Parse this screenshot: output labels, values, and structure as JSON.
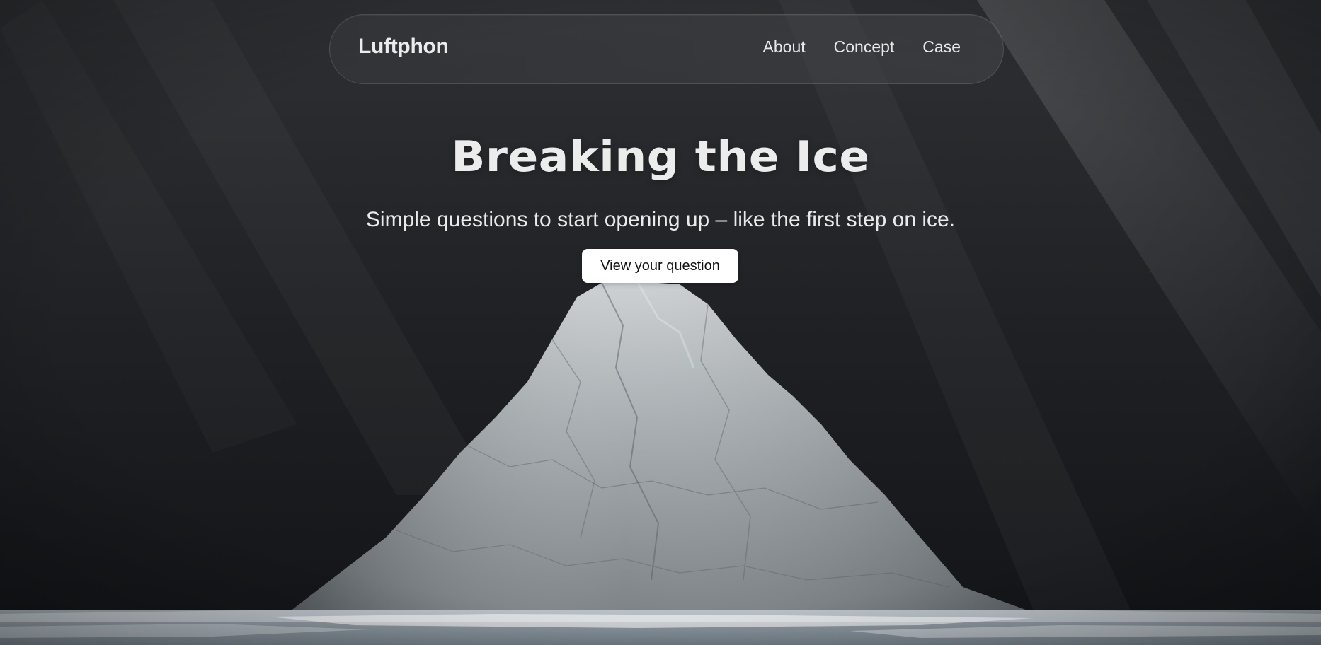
{
  "brand": {
    "name": "Luftphon"
  },
  "nav": {
    "links": [
      {
        "label": "About"
      },
      {
        "label": "Concept"
      },
      {
        "label": "Case"
      }
    ]
  },
  "hero": {
    "title": "Breaking the Ice",
    "subtitle": "Simple questions to start opening up – like the first step on ice.",
    "cta_label": "View your question"
  },
  "colors": {
    "background": "#1b1d20",
    "text": "#ececec",
    "button_bg": "#ffffff",
    "button_text": "#111111",
    "ice": "#9ea4a8"
  }
}
